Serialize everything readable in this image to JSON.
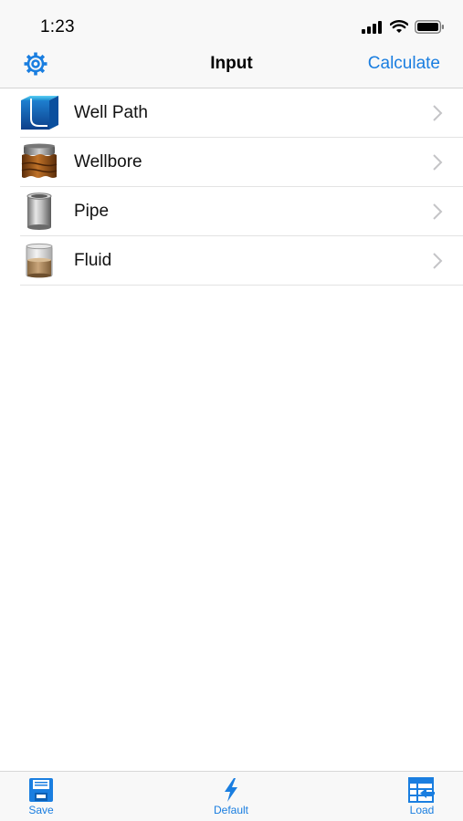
{
  "status_bar": {
    "time": "1:23"
  },
  "nav": {
    "title": "Input",
    "right_button": "Calculate",
    "left_icon": "gear-icon"
  },
  "list": {
    "items": [
      {
        "label": "Well Path",
        "icon": "well-path-icon"
      },
      {
        "label": "Wellbore",
        "icon": "wellbore-icon"
      },
      {
        "label": "Pipe",
        "icon": "pipe-icon"
      },
      {
        "label": "Fluid",
        "icon": "fluid-beaker-icon"
      }
    ]
  },
  "tab_bar": {
    "tabs": [
      {
        "label": "Save",
        "icon": "floppy-disk-icon"
      },
      {
        "label": "Default",
        "icon": "lightning-bolt-icon"
      },
      {
        "label": "Load",
        "icon": "load-table-icon"
      }
    ]
  },
  "colors": {
    "accent": "#1a7ee0",
    "background": "#ffffff",
    "bar_background": "#f8f8f8"
  }
}
